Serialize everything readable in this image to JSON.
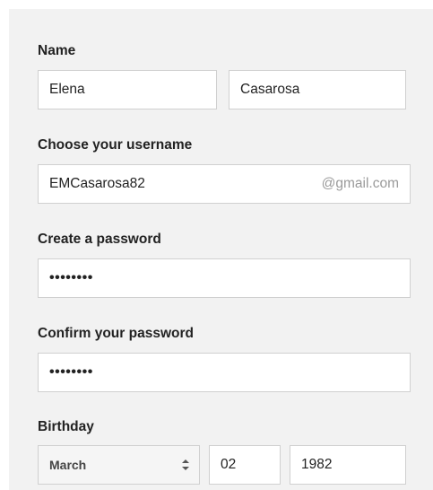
{
  "form": {
    "name_label": "Name",
    "first_name": "Elena",
    "last_name": "Casarosa",
    "username_label": "Choose your username",
    "username": "EMCasarosa82",
    "username_suffix": "@gmail.com",
    "password_label": "Create a password",
    "password_mask": "••••••••",
    "confirm_label": "Confirm your password",
    "confirm_mask": "••••••••",
    "birthday_label": "Birthday",
    "birth_month": "March",
    "birth_day": "02",
    "birth_year": "1982",
    "select_arrow_icon": "up-down-chevron-icon"
  }
}
